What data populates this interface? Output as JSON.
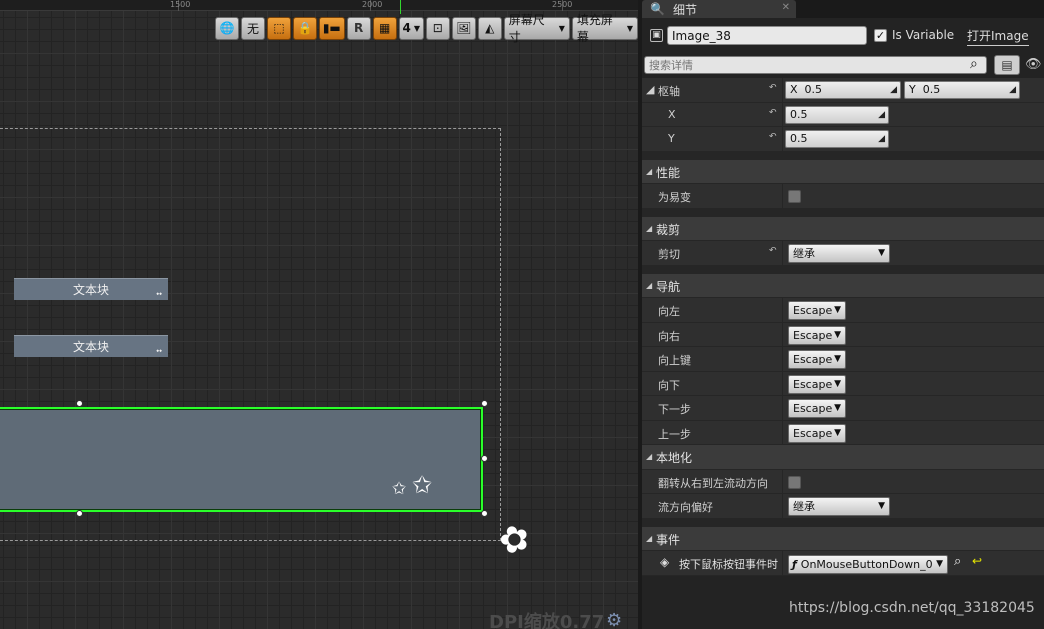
{
  "ruler": {
    "labels": [
      "1500",
      "2000",
      "2500"
    ]
  },
  "toolbar": {
    "none_label": "无",
    "r_label": "R",
    "grid_snap_value": "4",
    "screen_size_label": "屏幕尺寸",
    "fill_screen_label": "填充屏幕"
  },
  "canvas": {
    "text_blocks": [
      "文本块",
      "文本块"
    ]
  },
  "dpi": {
    "label": "DPI缩放0.77"
  },
  "details": {
    "tab_label": "细节",
    "widget_name": "Image_38",
    "is_variable_label": "Is Variable",
    "is_variable_checked": true,
    "open_image_label": "打开Image",
    "search_placeholder": "搜索详情",
    "pivot": {
      "label": "枢轴",
      "x_label": "X",
      "y_label": "Y",
      "x_value": "0.5",
      "y_value": "0.5"
    },
    "performance": {
      "label": "性能",
      "volatile_label": "为易变"
    },
    "clipping": {
      "label": "裁剪",
      "clip_label": "剪切",
      "clip_value": "继承"
    },
    "navigation": {
      "label": "导航",
      "rows": [
        {
          "label": "向左",
          "value": "Escape"
        },
        {
          "label": "向右",
          "value": "Escape"
        },
        {
          "label": "向上键",
          "value": "Escape"
        },
        {
          "label": "向下",
          "value": "Escape"
        },
        {
          "label": "下一步",
          "value": "Escape"
        },
        {
          "label": "上一步",
          "value": "Escape"
        }
      ]
    },
    "localization": {
      "label": "本地化",
      "flip_label": "翻转从右到左流动方向",
      "flow_label": "流方向偏好",
      "flow_value": "继承"
    },
    "events": {
      "label": "事件",
      "mouse_down_label": "按下鼠标按钮事件时",
      "mouse_down_value": "OnMouseButtonDown_0"
    }
  },
  "watermark": "https://blog.csdn.net/qq_33182045"
}
